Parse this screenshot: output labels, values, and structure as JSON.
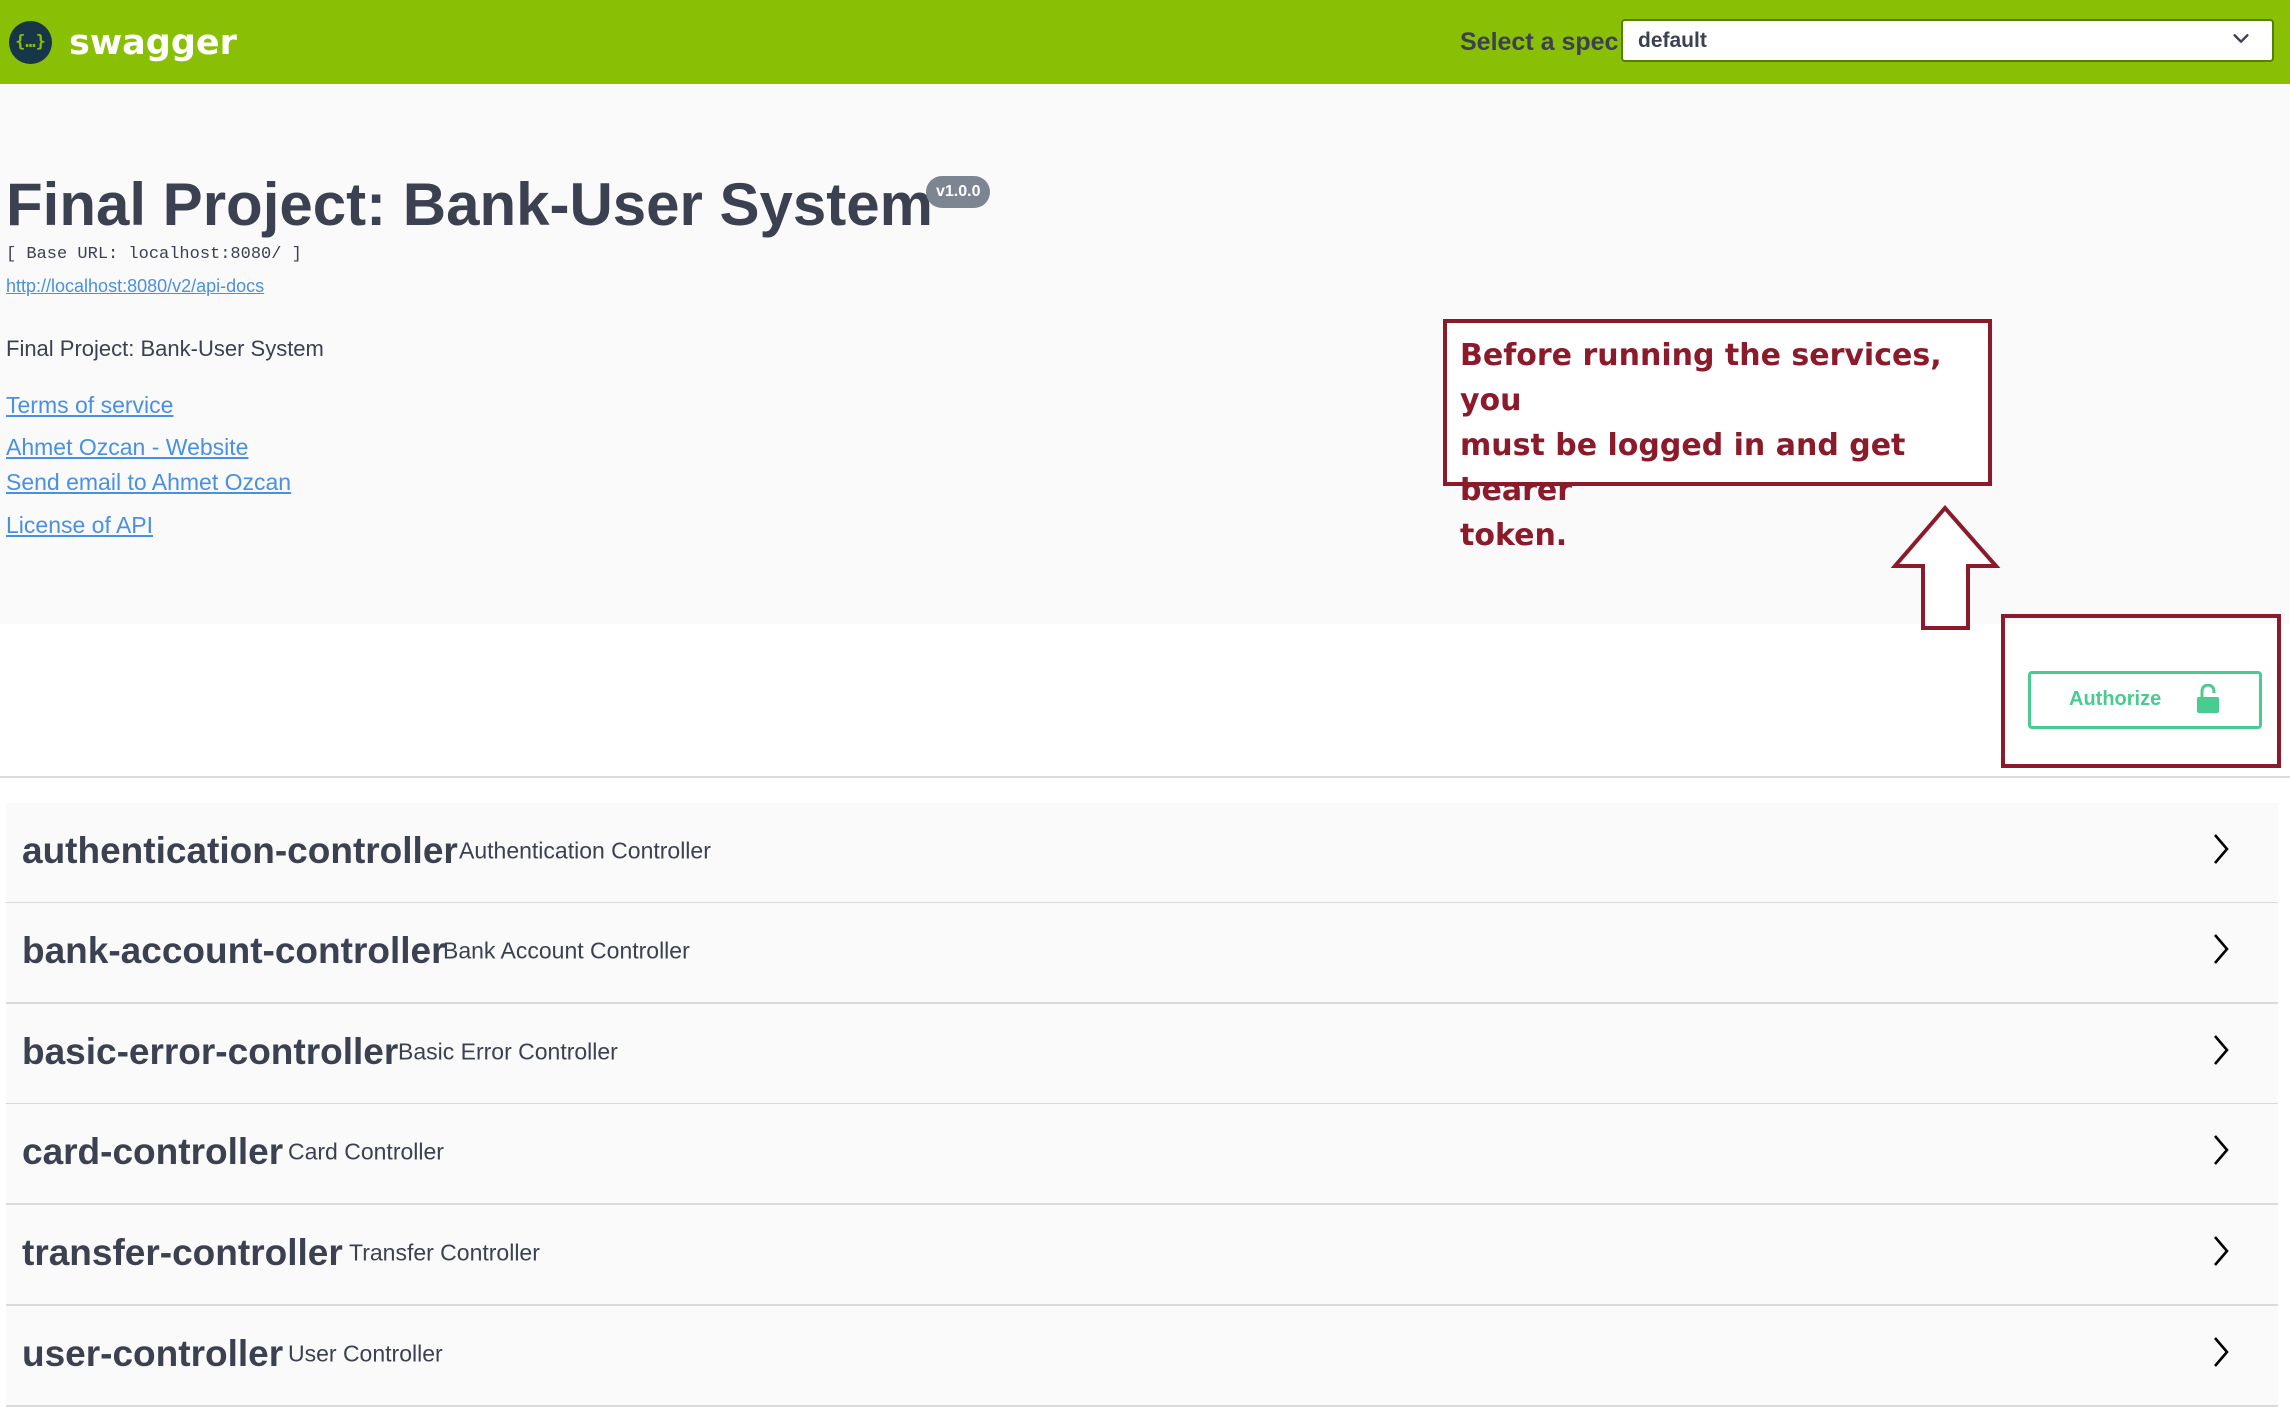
{
  "topbar": {
    "logo_glyph": "{…}",
    "logo_text": "swagger",
    "spec_label": "Select a spec",
    "spec_value": "default",
    "colors": {
      "bar": "#89bf04",
      "logo": "#173647"
    }
  },
  "info": {
    "title": "Final Project: Bank-User System",
    "version": "v1.0.0",
    "base_url": "[ Base URL: localhost:8080/ ]",
    "docs_url": "http://localhost:8080/v2/api-docs",
    "description": "Final Project: Bank-User System",
    "terms_link": "Terms of service",
    "website_link": "Ahmet Ozcan - Website",
    "email_link": "Send email to Ahmet Ozcan",
    "license_link": "License of API"
  },
  "annotation": {
    "note": "Before running the services, you must be logged in and get bearer token.",
    "lines": [
      "Before running the services, you",
      "must be logged in and get bearer",
      "token."
    ],
    "color": "#8b1a2b",
    "icon": "up-arrow-icon"
  },
  "auth": {
    "label": "Authorize",
    "icon": "unlocked-padlock-icon",
    "color": "#49cc90"
  },
  "tags": [
    {
      "name": "authentication-controller",
      "description": "Authentication Controller"
    },
    {
      "name": "bank-account-controller",
      "description": "Bank Account Controller"
    },
    {
      "name": "basic-error-controller",
      "description": "Basic Error Controller"
    },
    {
      "name": "card-controller",
      "description": "Card Controller"
    },
    {
      "name": "transfer-controller",
      "description": "Transfer Controller"
    },
    {
      "name": "user-controller",
      "description": "User Controller"
    }
  ]
}
